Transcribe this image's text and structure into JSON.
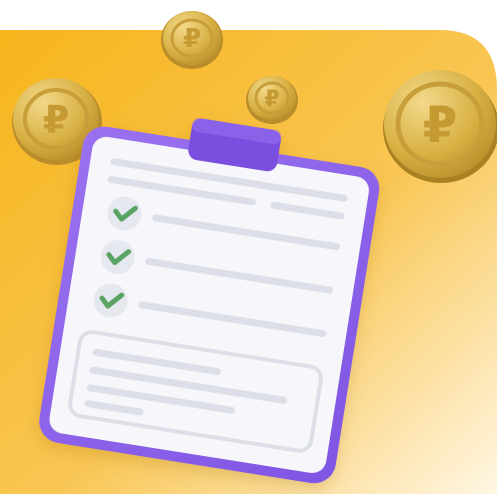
{
  "illustration": {
    "coin_symbol": "₽",
    "colors": {
      "background": "#ffffff",
      "panel_orange": "#f6b520",
      "panel_light": "#fde7b0",
      "clipboard_purple": "#8f63e8",
      "clip_purple": "#7a4fe0",
      "paper": "#f7f7fb",
      "line_gray": "#dadde6",
      "check_green": "#5aa463",
      "coin_gold": "#d8b144",
      "coin_dark": "#b58b28"
    }
  }
}
